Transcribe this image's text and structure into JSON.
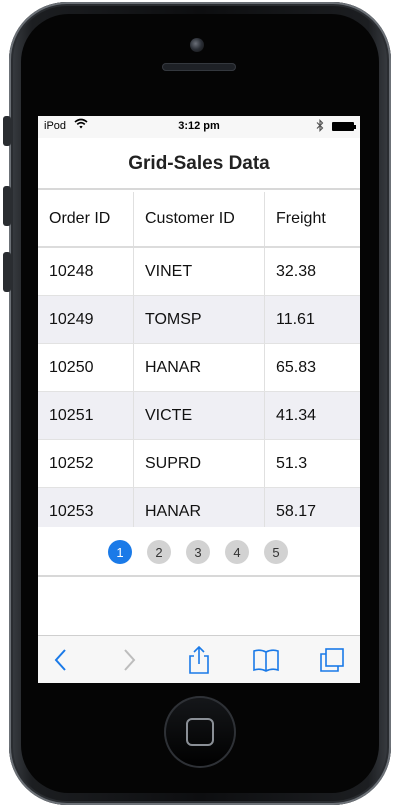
{
  "statusbar": {
    "carrier": "iPod",
    "time": "3:12 pm"
  },
  "title": "Grid-Sales Data",
  "grid": {
    "columns": [
      "Order ID",
      "Customer ID",
      "Freight"
    ],
    "rows": [
      [
        "10248",
        "VINET",
        "32.38"
      ],
      [
        "10249",
        "TOMSP",
        "11.61"
      ],
      [
        "10250",
        "HANAR",
        "65.83"
      ],
      [
        "10251",
        "VICTE",
        "41.34"
      ],
      [
        "10252",
        "SUPRD",
        "51.3"
      ],
      [
        "10253",
        "HANAR",
        "58.17"
      ]
    ]
  },
  "pager": {
    "pages": [
      "1",
      "2",
      "3",
      "4",
      "5"
    ],
    "active_page": "1"
  },
  "colors": {
    "accent": "#1a7ae8",
    "alt_row": "#efeff4",
    "page_inactive": "#d2d2d2"
  },
  "toolbar": {
    "icons": [
      "back-icon",
      "forward-icon",
      "share-icon",
      "bookmarks-icon",
      "tabs-icon"
    ]
  }
}
